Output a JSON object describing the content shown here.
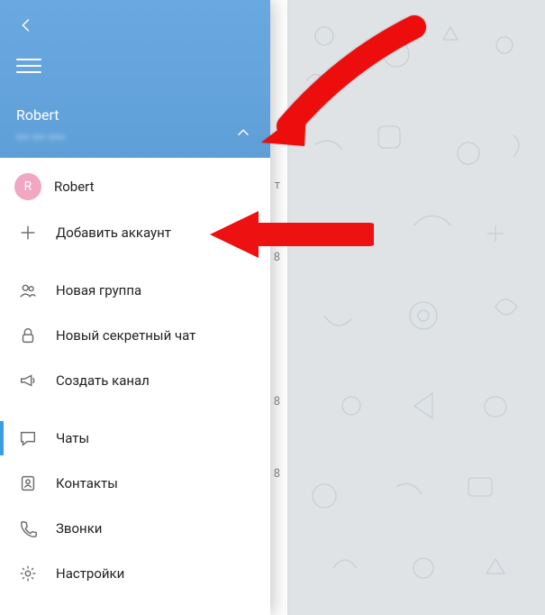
{
  "header": {
    "account_name": "Robert",
    "account_phone": "••• ••• ••••"
  },
  "accounts": {
    "current": {
      "initial": "R",
      "name": "Robert"
    },
    "add_label": "Добавить аккаунт"
  },
  "menu": {
    "new_group": "Новая группа",
    "new_secret": "Новый секретный чат",
    "new_channel": "Создать канал",
    "chats": "Чаты",
    "contacts": "Контакты",
    "calls": "Звонки",
    "settings": "Настройки"
  },
  "chat_peek": {
    "text1": "т",
    "badge1": "8",
    "badge2": "8",
    "badge3": "8"
  }
}
